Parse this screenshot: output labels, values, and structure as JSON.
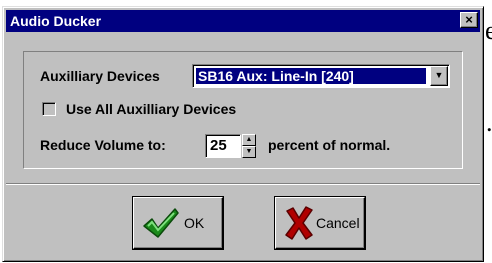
{
  "background_fragments": [
    "e",
    "."
  ],
  "window": {
    "title": "Audio Ducker",
    "close_glyph": "×"
  },
  "devices": {
    "label": "Auxilliary Devices",
    "selected": "SB16 Aux: Line-In [240]",
    "dropdown_glyph": "▼"
  },
  "use_all": {
    "label": "Use All Auxilliary Devices",
    "checked": false
  },
  "reduce": {
    "label": "Reduce Volume to:",
    "value": "25",
    "suffix": "percent of normal.",
    "up_glyph": "▲",
    "down_glyph": "▼"
  },
  "buttons": {
    "ok_label": "OK",
    "cancel_label": "Cancel"
  },
  "colors": {
    "titlebar": "#000080",
    "face": "#c0c0c0",
    "check_icon": "#1a8a1a",
    "cancel_icon": "#b00000"
  }
}
